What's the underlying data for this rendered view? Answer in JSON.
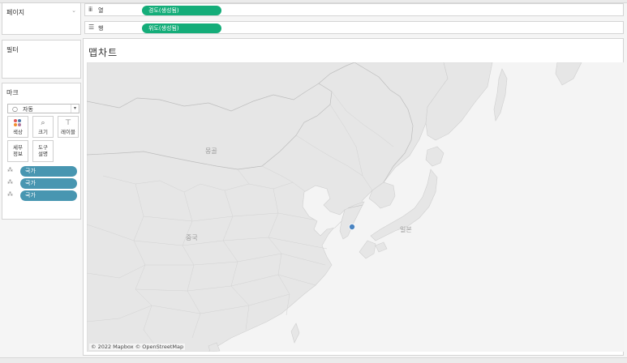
{
  "panels": {
    "pages_title": "페이지",
    "filters_title": "필터",
    "marks_title": "마크",
    "mark_type": "자동",
    "mark_buttons": {
      "color": "색상",
      "size": "크기",
      "label": "레이블",
      "detail_line1": "세부",
      "detail_line2": "정보",
      "tooltip_line1": "도구",
      "tooltip_line2": "설명"
    },
    "mark_pills": [
      "국가",
      "국가",
      "국가"
    ]
  },
  "shelves": {
    "columns_label": "열",
    "columns_pill": "경도(생성됨)",
    "rows_label": "행",
    "rows_pill": "위도(생성됨)"
  },
  "view": {
    "title": "맵차트",
    "map_labels": {
      "mongolia": "몽골",
      "china": "중국",
      "japan": "일본"
    },
    "data_point": "대한민국",
    "credit": "© 2022 Mapbox © OpenStreetMap"
  },
  "colors": {
    "pill_green": "#14ad79",
    "pill_blue": "#4896b1",
    "data_point": "#4a84c1",
    "land": "#e6e6e6",
    "sea": "#f5f5f5"
  }
}
